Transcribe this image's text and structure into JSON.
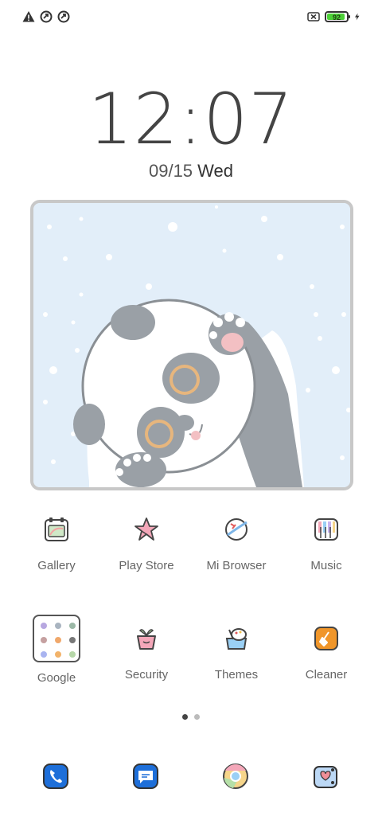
{
  "status_bar": {
    "left_icons": [
      "warning-icon",
      "sync-icon",
      "sync-icon-2"
    ],
    "battery_level": "92",
    "right_icons": [
      "no-sim-icon",
      "battery-icon",
      "charging-bolt-icon"
    ]
  },
  "clock": {
    "time": "12:07",
    "date": "09/15",
    "weekday": "Wed"
  },
  "apps": [
    {
      "label": "Gallery",
      "icon": "gallery-icon"
    },
    {
      "label": "Play Store",
      "icon": "play-store-icon"
    },
    {
      "label": "Mi Browser",
      "icon": "mi-browser-icon"
    },
    {
      "label": "Music",
      "icon": "music-icon"
    },
    {
      "label": "Google",
      "icon": "google-folder-icon"
    },
    {
      "label": "Security",
      "icon": "security-icon"
    },
    {
      "label": "Themes",
      "icon": "themes-icon"
    },
    {
      "label": "Cleaner",
      "icon": "cleaner-icon"
    }
  ],
  "pages": {
    "count": 2,
    "active": 1
  },
  "dock": [
    {
      "icon": "phone-icon"
    },
    {
      "icon": "messages-icon"
    },
    {
      "icon": "chrome-icon"
    },
    {
      "icon": "camera-icon"
    }
  ],
  "colors": {
    "battery_fill": "#4cd137",
    "widget_bg": "#e2eef9",
    "dock_blue": "#1e6fd9",
    "cleaner_orange": "#f0962a"
  }
}
